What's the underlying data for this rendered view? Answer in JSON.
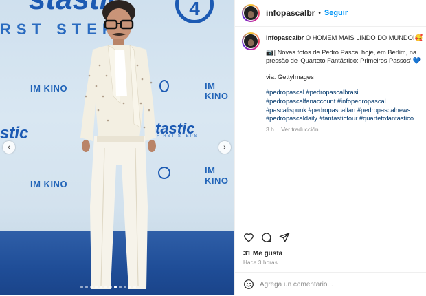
{
  "photo": {
    "backdrop": {
      "brand_top": "stastic",
      "brand_mid": "tastic",
      "brand_left": "stic",
      "tagline": "RST STEPS",
      "tagline_small": "FIRST STEPS",
      "kino_1": "IM KINO",
      "kino_2": "IM KINO",
      "kino_3": "IM KINO",
      "kino_4": "IM KINO",
      "logo_num": "4"
    },
    "carousel": {
      "dots": 12,
      "active_dot": 7
    },
    "colors": {
      "backdrop": "#d5e4f0",
      "brand_blue": "#1c5ab3",
      "carpet": "#1f4d97"
    }
  },
  "post": {
    "username": "infopascalbr",
    "separator": "•",
    "follow_label": "Seguir",
    "caption_user": "infopascalbr",
    "caption_title": "O HOMEM MAIS LINDO DO MUNDO!🥰",
    "caption_line": "📷| Novas fotos de Pedro Pascal hoje, em Berlim, na pressão de 'Quarteto Fantástico: Primeiros Passos'.💙",
    "caption_via": "via: GettyImages",
    "hashtags": "#pedropascal #pedropascalbrasil #pedropascalfanaccount #infopedropascal #pascalispunk #pedropascalfan #pedropascalnews #pedropascaldaily #fantasticfour #quartetofantastico",
    "time": "3 h",
    "translate": "Ver traducción",
    "likes": "31 Me gusta",
    "posted_ago": "Hace 3 horas",
    "comment_placeholder": "Agrega un comentario..."
  },
  "icons": {
    "like": "heart-icon",
    "comment": "comment-icon",
    "share": "send-icon",
    "emoji": "emoji-icon",
    "prev": "chevron-left-icon",
    "next": "chevron-right-icon"
  },
  "colors": {
    "accent": "#0095f6",
    "text": "#262626",
    "muted": "#8e8e8e",
    "link": "#00376b"
  }
}
